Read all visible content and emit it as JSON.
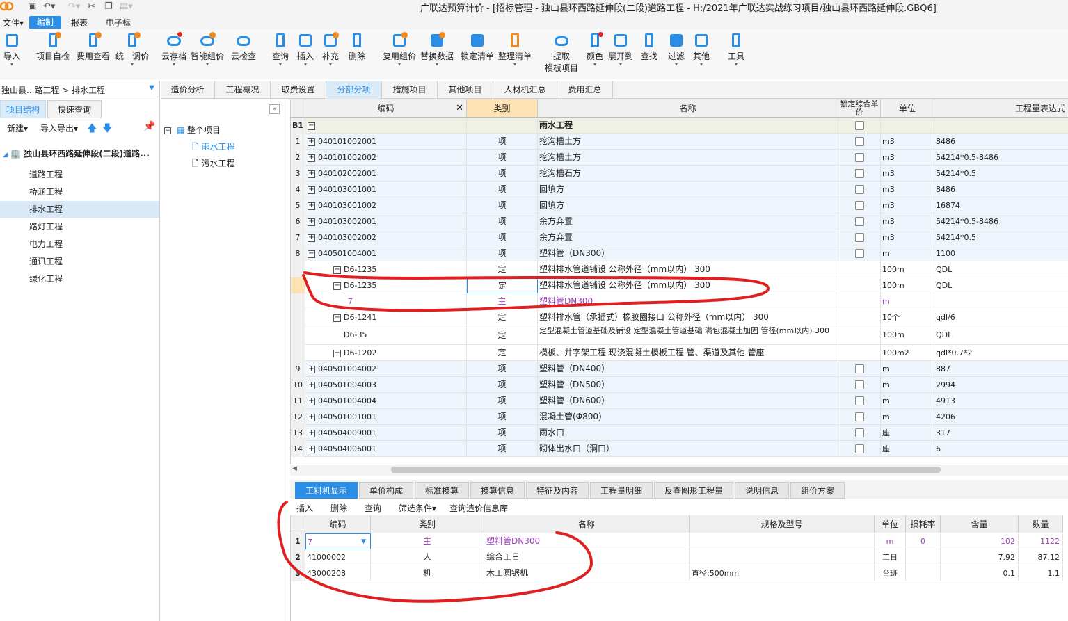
{
  "window": {
    "title": "广联达预算计价 - [招标管理 - 独山县环西路延伸段(二段)道路工程 - H:/2021年广联达实战练习项目/独山县环西路延伸段.GBQ6]"
  },
  "menus": [
    "文件",
    "编制",
    "报表",
    "电子标"
  ],
  "ribbon": [
    "导入",
    "项目自检",
    "费用查看",
    "统一调价",
    "云存档",
    "智能组价",
    "云检查",
    "查询",
    "插入",
    "补充",
    "删除",
    "复用组价",
    "替换数据",
    "锁定清单",
    "整理清单",
    "提取",
    "模板项目",
    "颜色",
    "展开到",
    "查找",
    "过滤",
    "其他",
    "工具"
  ],
  "breadcrumb": "独山县...路工程 > 排水工程",
  "left_tabs": [
    "项目结构",
    "快速查询"
  ],
  "left_tools": {
    "new": "新建",
    "io": "导入导出"
  },
  "tree": {
    "root": "独山县环西路延伸段(二段)道路...",
    "items": [
      "道路工程",
      "桥涵工程",
      "排水工程",
      "路灯工程",
      "电力工程",
      "通讯工程",
      "绿化工程"
    ]
  },
  "mid_tree": {
    "root": "整个项目",
    "items": [
      "雨水工程",
      "污水工程"
    ]
  },
  "top_tabs": [
    "造价分析",
    "工程概况",
    "取费设置",
    "分部分项",
    "措施项目",
    "其他项目",
    "人材机汇总",
    "费用汇总"
  ],
  "grid": {
    "headers": {
      "code": "编码",
      "kind": "类别",
      "name": "名称",
      "lock": "锁定综合单价",
      "unit": "单位",
      "expr": "工程量表达式"
    },
    "section": {
      "rn": "B1",
      "name": "雨水工程"
    },
    "rows": [
      {
        "rn": "1",
        "code": "040101002001",
        "kind": "项",
        "name": "挖沟槽土方",
        "unit": "m3",
        "expr": "8486"
      },
      {
        "rn": "2",
        "code": "040101002002",
        "kind": "项",
        "name": "挖沟槽土方",
        "unit": "m3",
        "expr": "54214*0.5-8486"
      },
      {
        "rn": "3",
        "code": "040102002001",
        "kind": "项",
        "name": "挖沟槽石方",
        "unit": "m3",
        "expr": "54214*0.5"
      },
      {
        "rn": "4",
        "code": "040103001001",
        "kind": "项",
        "name": "回填方",
        "unit": "m3",
        "expr": "8486"
      },
      {
        "rn": "5",
        "code": "040103001002",
        "kind": "项",
        "name": "回填方",
        "unit": "m3",
        "expr": "16874"
      },
      {
        "rn": "6",
        "code": "040103002001",
        "kind": "项",
        "name": "余方弃置",
        "unit": "m3",
        "expr": "54214*0.5-8486"
      },
      {
        "rn": "7",
        "code": "040103002002",
        "kind": "项",
        "name": "余方弃置",
        "unit": "m3",
        "expr": "54214*0.5"
      },
      {
        "rn": "8",
        "code": "040501004001",
        "kind": "项",
        "name": "塑料管（DN300）",
        "unit": "m",
        "expr": "1100"
      },
      {
        "rn": "",
        "code": "D6-1235",
        "kind": "定",
        "name": "塑料排水管道铺设 公称外径（mm以内） 300",
        "unit": "100m",
        "expr": "QDL"
      },
      {
        "rn": "",
        "code": "D6-1235",
        "kind": "定",
        "name": "塑料排水管道铺设 公称外径（mm以内） 300",
        "unit": "100m",
        "expr": "QDL"
      },
      {
        "rn": "",
        "code": "7",
        "kind": "主",
        "name": "塑料管DN300",
        "unit": "m",
        "expr": ""
      },
      {
        "rn": "",
        "code": "D6-1241",
        "kind": "定",
        "name": "塑料排水管（承插式）橡胶圈接口 公称外径（mm以内） 300",
        "unit": "10个",
        "expr": "qdl/6"
      },
      {
        "rn": "",
        "code": "D6-35",
        "kind": "定",
        "name": "定型混凝土管道基础及铺设 定型混凝土管道基础 满包混凝土加固 管径(mm以内) 300",
        "unit": "100m",
        "expr": "QDL"
      },
      {
        "rn": "",
        "code": "D6-1202",
        "kind": "定",
        "name": "模板、井字架工程 现浇混凝土模板工程 管、渠道及其他 管座",
        "unit": "100m2",
        "expr": "qdl*0.7*2"
      },
      {
        "rn": "9",
        "code": "040501004002",
        "kind": "项",
        "name": "塑料管（DN400）",
        "unit": "m",
        "expr": "887"
      },
      {
        "rn": "10",
        "code": "040501004003",
        "kind": "项",
        "name": "塑料管（DN500）",
        "unit": "m",
        "expr": "2994"
      },
      {
        "rn": "11",
        "code": "040501004004",
        "kind": "项",
        "name": "塑料管（DN600）",
        "unit": "m",
        "expr": "4913"
      },
      {
        "rn": "12",
        "code": "040501001001",
        "kind": "项",
        "name": "混凝土管(Φ800)",
        "unit": "m",
        "expr": "4206"
      },
      {
        "rn": "13",
        "code": "040504009001",
        "kind": "项",
        "name": "雨水口",
        "unit": "座",
        "expr": "317"
      },
      {
        "rn": "14",
        "code": "040504006001",
        "kind": "项",
        "name": "砌体出水口（洞口）",
        "unit": "座",
        "expr": "6"
      }
    ]
  },
  "bottom_tabs": [
    "工料机显示",
    "单价构成",
    "标准换算",
    "换算信息",
    "特征及内容",
    "工程量明细",
    "反查图形工程量",
    "说明信息",
    "组价方案"
  ],
  "bottom_tools": [
    "插入",
    "删除",
    "查询",
    "筛选条件",
    "查询造价信息库"
  ],
  "bottom_grid": {
    "headers": {
      "code": "编码",
      "kind": "类别",
      "name": "名称",
      "spec": "规格及型号",
      "unit": "单位",
      "loss": "损耗率",
      "qty": "含量",
      "num": "数量"
    },
    "rows": [
      {
        "rn": "1",
        "code": "7",
        "kind": "主",
        "name": "塑料管DN300",
        "spec": "",
        "unit": "m",
        "loss": "0",
        "qty": "102",
        "num": "1122"
      },
      {
        "rn": "2",
        "code": "41000002",
        "kind": "人",
        "name": "综合工日",
        "spec": "",
        "unit": "工日",
        "loss": "",
        "qty": "7.92",
        "num": "87.12"
      },
      {
        "rn": "3",
        "code": "43000208",
        "kind": "机",
        "name": "木工圆锯机",
        "spec": "直径:500mm",
        "unit": "台班",
        "loss": "",
        "qty": "0.1",
        "num": "1.1"
      }
    ]
  },
  "colors": {
    "accent": "#2a8ee6",
    "highlight": "#e02020",
    "material": "#9b3fb5"
  }
}
